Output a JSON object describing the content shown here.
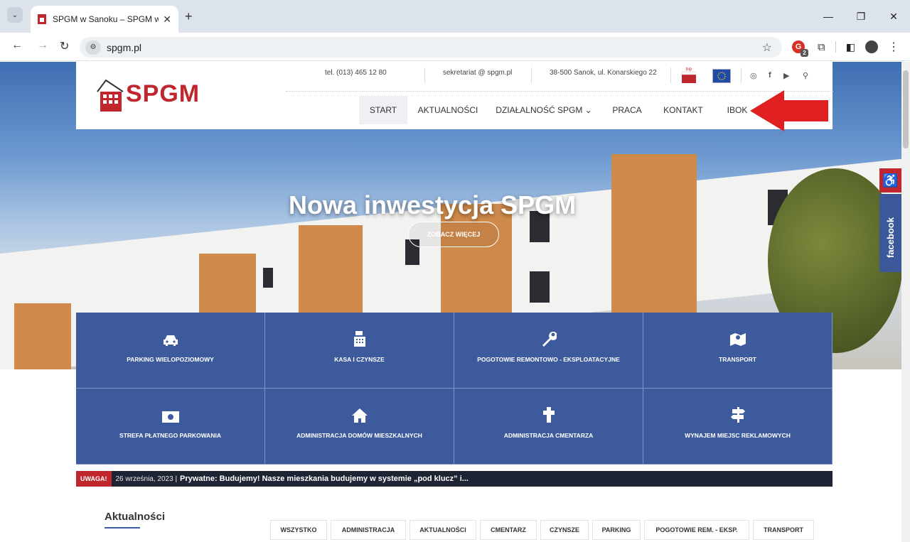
{
  "browser": {
    "tab_title": "SPGM w Sanoku – SPGM w San",
    "url": "spgm.pl",
    "new_tab": "+",
    "tab_close": "✕",
    "window": {
      "minimize": "—",
      "restore": "❐",
      "close": "✕"
    },
    "ext_badge": "2"
  },
  "header": {
    "logo_text": "SPGM",
    "phone": "tel. (013) 465 12 80",
    "email": "sekretariat @ spgm.pl",
    "address": "38-500 Sanok, ul. Konarskiego 22",
    "bip": "bip",
    "menu": [
      {
        "label": "START",
        "active": true
      },
      {
        "label": "AKTUALNOŚCI"
      },
      {
        "label": "DZIAŁALNOŚĆ SPGM ⌄"
      },
      {
        "label": "PRACA"
      },
      {
        "label": "KONTAKT"
      },
      {
        "label": "IBOK"
      }
    ]
  },
  "hero": {
    "title": "Nowa inwestycja SPGM",
    "button": "ZOBACZ WIĘCEJ"
  },
  "sidebar": {
    "accessibility": "♿",
    "facebook": "facebook"
  },
  "services": [
    {
      "label": "PARKING WIELOPOZIOMOWY",
      "icon": "car-icon"
    },
    {
      "label": "KASA I CZYNSZE",
      "icon": "cash-register-icon"
    },
    {
      "label": "POGOTOWIE REMONTOWO - EKSPLOATACYJNE",
      "icon": "wrench-icon"
    },
    {
      "label": "TRANSPORT",
      "icon": "map-icon"
    },
    {
      "label": "STREFA PŁATNEGO PARKOWANIA",
      "icon": "money-icon"
    },
    {
      "label": "ADMINISTRACJA DOMÓW MIESZKALNYCH",
      "icon": "house-icon"
    },
    {
      "label": "ADMINISTRACJA CMENTARZA",
      "icon": "cross-icon"
    },
    {
      "label": "WYNAJEM MIEJSC REKLAMOWYCH",
      "icon": "signpost-icon"
    }
  ],
  "ticker": {
    "tag": "UWAGA!",
    "date": "26 września, 2023 |",
    "headline": "Prywatne: Budujemy! Nasze mieszkania budujemy w systemie „pod klucz” i..."
  },
  "news": {
    "title": "Aktualności",
    "filters": [
      "WSZYSTKO",
      "ADMINISTRACJA",
      "AKTUALNOŚCI",
      "CMENTARZ",
      "CZYNSZE",
      "PARKING",
      "POGOTOWIE REM. - EKSP.",
      "TRANSPORT"
    ]
  },
  "colors": {
    "brand_red": "#c0262d",
    "tile_blue": "#3d5b9c",
    "ticker_bg": "#1e2433",
    "annotation_arrow": "#e02020"
  }
}
